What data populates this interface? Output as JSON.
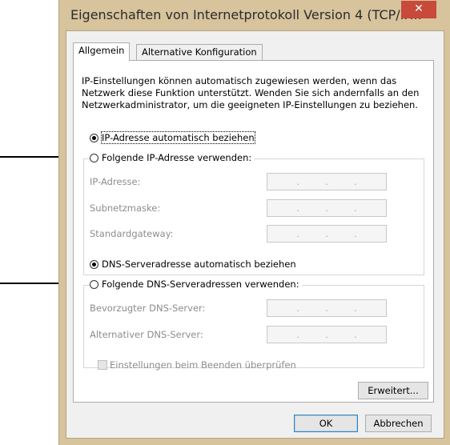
{
  "window": {
    "title": "Eigenschaften von Internetprotokoll Version 4 (TCP/IP...",
    "close_label": "✕"
  },
  "tabs": [
    {
      "label": "Allgemein",
      "active": true
    },
    {
      "label": "Alternative Konfiguration",
      "active": false
    }
  ],
  "intro_text": "IP-Einstellungen können automatisch zugewiesen werden, wenn das Netzwerk diese Funktion unterstützt. Wenden Sie sich andernfalls an den Netzwerkadministrator, um die geeigneten IP-Einstellungen zu beziehen.",
  "ip": {
    "auto_label": "IP-Adresse automatisch beziehen",
    "manual_label": "Folgende IP-Adresse verwenden:",
    "auto_selected": true,
    "fields": [
      {
        "label": "IP-Adresse:",
        "value": ". . ."
      },
      {
        "label": "Subnetzmaske:",
        "value": ". . ."
      },
      {
        "label": "Standardgateway:",
        "value": ". . ."
      }
    ]
  },
  "dns": {
    "auto_label": "DNS-Serveradresse automatisch beziehen",
    "manual_label": "Folgende DNS-Serveradressen verwenden:",
    "auto_selected": true,
    "fields": [
      {
        "label": "Bevorzugter DNS-Server:",
        "value": ". . ."
      },
      {
        "label": "Alternativer DNS-Server:",
        "value": ". . ."
      }
    ]
  },
  "validate_checkbox_label": "Einstellungen beim Beenden überprüfen",
  "buttons": {
    "advanced": "Erweitert...",
    "ok": "OK",
    "cancel": "Abbrechen"
  },
  "colors": {
    "window_frame": "#d7c39c",
    "close_button": "#c74a3a",
    "default_button_border": "#3c7fb1"
  }
}
